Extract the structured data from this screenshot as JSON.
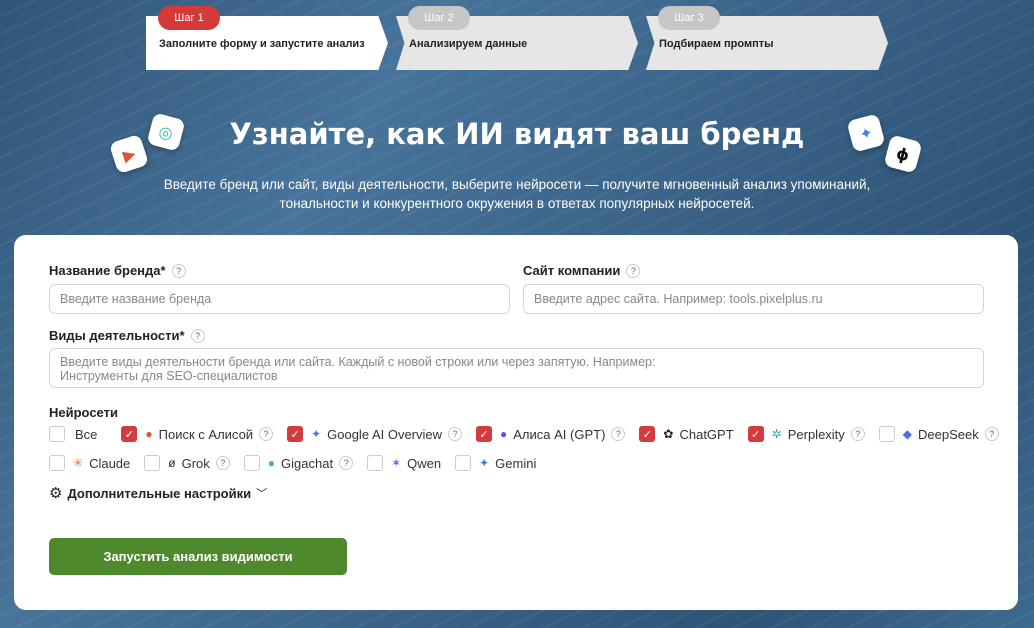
{
  "steps": [
    {
      "badge": "Шаг 1",
      "label": "Заполните форму и запустите анализ"
    },
    {
      "badge": "Шаг 2",
      "label": "Анализируем данные"
    },
    {
      "badge": "Шаг 3",
      "label": "Подбираем промпты"
    }
  ],
  "hero": {
    "title": "Узнайте, как ИИ видят ваш бренд",
    "subtitle_line1": "Введите бренд или сайт, виды деятельности, выберите нейросети — получите мгновенный анализ упоминаний,",
    "subtitle_line2": "тональности и конкурентного окружения в ответах популярных нейросетей."
  },
  "form": {
    "brand_label": "Название бренда*",
    "brand_placeholder": "Введите название бренда",
    "site_label": "Сайт компании",
    "site_placeholder": "Введите адрес сайта. Например: tools.pixelplus.ru",
    "activity_label": "Виды деятельности*",
    "activity_placeholder_line1": "Введите виды деятельности бренда или сайта. Каждый с новой строки или через запятую. Например:",
    "activity_placeholder_line2": "Инструменты для SEO-специалистов",
    "help": "?",
    "networks_label": "Нейросети",
    "networks": [
      {
        "label": "Все",
        "checked": false
      },
      {
        "label": "Поиск с Алисой",
        "checked": true
      },
      {
        "label": "Google AI Overview",
        "checked": true
      },
      {
        "label": "Алиса AI (GPT)",
        "checked": true
      },
      {
        "label": "ChatGPT",
        "checked": true
      },
      {
        "label": "Perplexity",
        "checked": true
      },
      {
        "label": "DeepSeek",
        "checked": false
      },
      {
        "label": "Claude",
        "checked": false
      },
      {
        "label": "Grok",
        "checked": false
      },
      {
        "label": "Gigachat",
        "checked": false
      },
      {
        "label": "Qwen",
        "checked": false
      },
      {
        "label": "Gemini",
        "checked": false
      }
    ],
    "advanced": "Дополнительные настройки",
    "submit": "Запустить анализ видимости"
  },
  "colors": {
    "accent": "#d23c3c",
    "submit": "#4e8a2d"
  }
}
